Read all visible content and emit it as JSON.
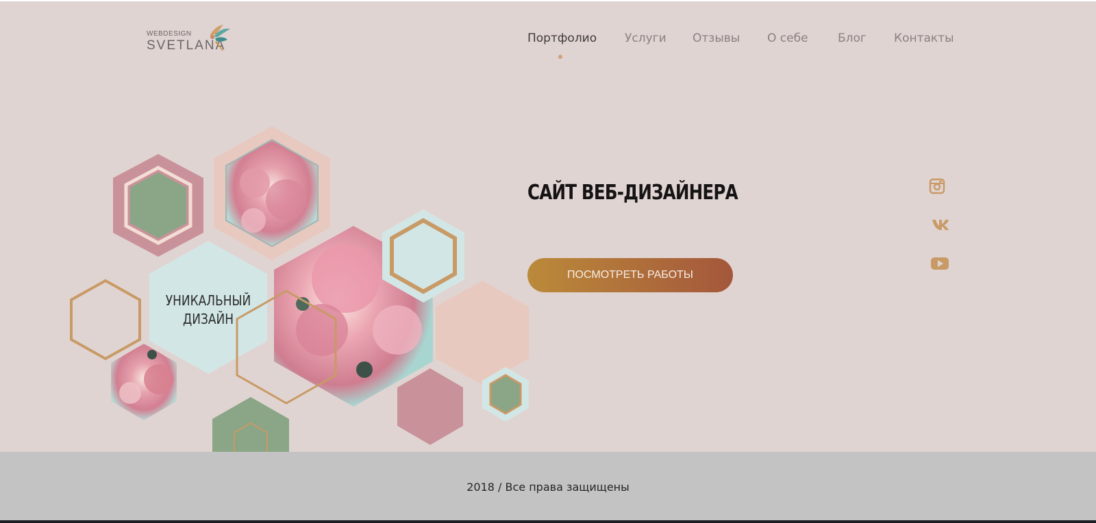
{
  "logo": {
    "small_text": "WEBDESIGN",
    "big_text": "SVETLANA"
  },
  "nav": {
    "items": [
      {
        "label": "Портфолио",
        "active": true
      },
      {
        "label": "Услуги",
        "active": false
      },
      {
        "label": "Отзывы",
        "active": false
      },
      {
        "label": "О себе",
        "active": false
      },
      {
        "label": "Блог",
        "active": false
      },
      {
        "label": "Контакты",
        "active": false
      }
    ]
  },
  "hero": {
    "hex_label_line1": "УНИКАЛЬНЫЙ",
    "hex_label_line2": "ДИЗАЙН",
    "title": "САЙТ ВЕБ-ДИЗАЙНЕРА",
    "button_label": "ПОСМОТРЕТЬ РАБОТЫ"
  },
  "social": [
    "instagram-icon",
    "vk-icon",
    "youtube-icon"
  ],
  "footer": {
    "text": "2018 / Все права защищены"
  },
  "colors": {
    "background": "#e0d4d2",
    "accent_gold": "#c89a66",
    "footer_bg": "#c3c3c3",
    "mint": "#d2e6e6",
    "rose": "#c9929a",
    "peach": "#e8c9bf",
    "sage": "#8ba587"
  }
}
